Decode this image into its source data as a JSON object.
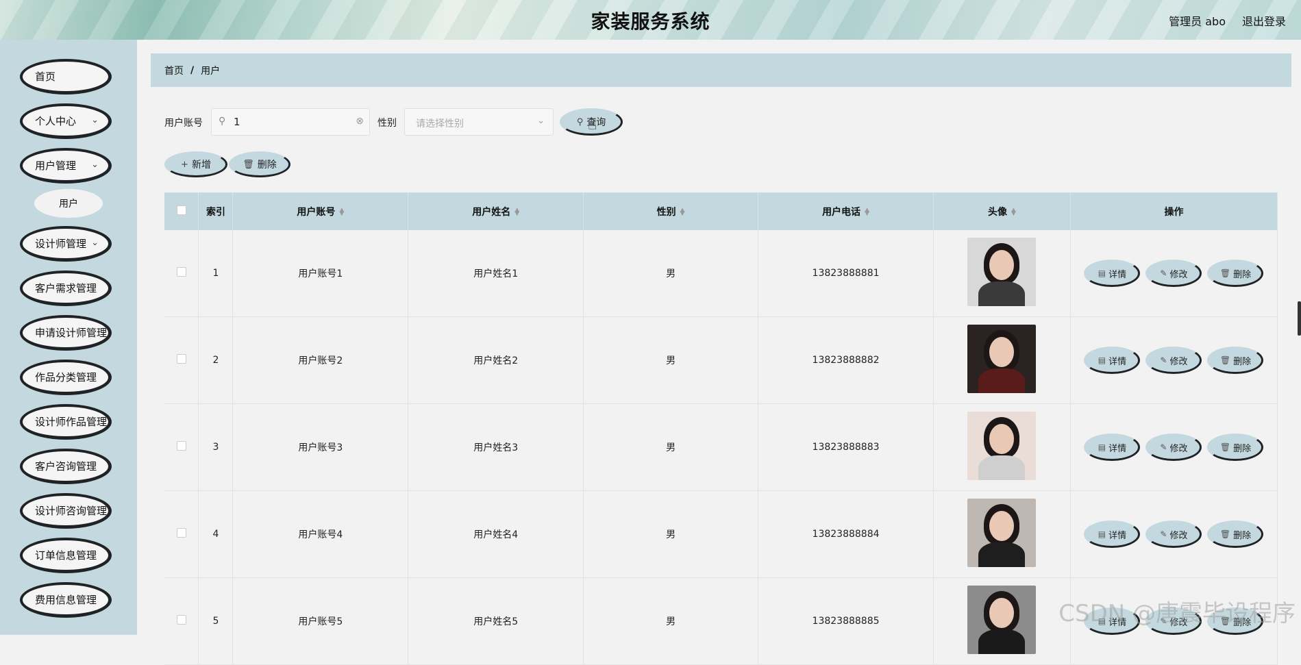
{
  "header": {
    "title": "家装服务系统",
    "user": "管理员 abo",
    "logout": "退出登录"
  },
  "sidebar": {
    "items": [
      {
        "label": "首页",
        "has_arrow": false
      },
      {
        "label": "个人中心",
        "has_arrow": true
      },
      {
        "label": "用户管理",
        "has_arrow": true
      },
      {
        "label": "设计师管理",
        "has_arrow": true
      },
      {
        "label": "客户需求管理",
        "has_arrow": false
      },
      {
        "label": "申请设计师管理",
        "has_arrow": false
      },
      {
        "label": "作品分类管理",
        "has_arrow": false
      },
      {
        "label": "设计师作品管理",
        "has_arrow": false
      },
      {
        "label": "客户咨询管理",
        "has_arrow": false
      },
      {
        "label": "设计师咨询管理",
        "has_arrow": false
      },
      {
        "label": "订单信息管理",
        "has_arrow": false
      },
      {
        "label": "费用信息管理",
        "has_arrow": false
      }
    ],
    "sub_item": "用户"
  },
  "breadcrumb": {
    "home": "首页",
    "separator": "/",
    "current": "用户"
  },
  "filters": {
    "account_label": "用户账号",
    "account_value": "1",
    "gender_label": "性别",
    "gender_placeholder": "请选择性别",
    "search_button": "查询"
  },
  "actions": {
    "add": "新增",
    "delete": "删除"
  },
  "table": {
    "headers": [
      "索引",
      "用户账号",
      "用户姓名",
      "性别",
      "用户电话",
      "头像",
      "操作"
    ],
    "rows": [
      {
        "index": "1",
        "account": "用户账号1",
        "name": "用户姓名1",
        "gender": "男",
        "phone": "13823888881"
      },
      {
        "index": "2",
        "account": "用户账号2",
        "name": "用户姓名2",
        "gender": "男",
        "phone": "13823888882"
      },
      {
        "index": "3",
        "account": "用户账号3",
        "name": "用户姓名3",
        "gender": "男",
        "phone": "13823888883"
      },
      {
        "index": "4",
        "account": "用户账号4",
        "name": "用户姓名4",
        "gender": "男",
        "phone": "13823888884"
      },
      {
        "index": "5",
        "account": "用户账号5",
        "name": "用户姓名5",
        "gender": "男",
        "phone": "13823888885"
      }
    ],
    "row_buttons": {
      "detail": "详情",
      "edit": "修改",
      "delete": "删除"
    }
  },
  "watermark": "CSDN @唐震毕设程序",
  "colors": {
    "accent": "#c3d9df",
    "border_dark": "#1f2326",
    "background": "#f2f2f2"
  }
}
